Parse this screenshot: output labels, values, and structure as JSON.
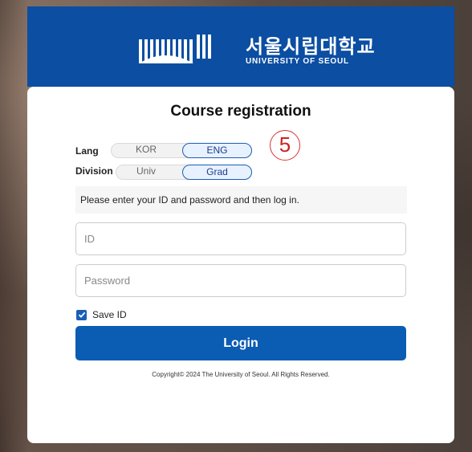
{
  "header": {
    "logo_korean": "서울시립대학교",
    "logo_english": "UNIVERSITY OF SEOUL",
    "logo_icon": "uos-emblem-icon",
    "brand_color": "#0b4ea2"
  },
  "page": {
    "title": "Course registration"
  },
  "lang": {
    "label": "Lang",
    "options": [
      "KOR",
      "ENG"
    ],
    "selected": "ENG"
  },
  "division": {
    "label": "Division",
    "options": [
      "Univ",
      "Grad"
    ],
    "selected": "Grad"
  },
  "annotation": {
    "marker": "5"
  },
  "notice": "Please enter your ID and password and then log in.",
  "form": {
    "id_placeholder": "ID",
    "id_value": "",
    "password_placeholder": "Password",
    "password_value": "",
    "save_id_label": "Save ID",
    "save_id_checked": true,
    "login_label": "Login"
  },
  "footer": {
    "copyright": "Copyright© 2024 The University of Seoul. All Rights Reserved."
  }
}
